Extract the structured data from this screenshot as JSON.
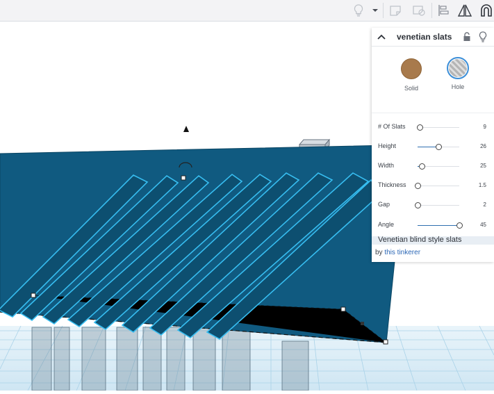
{
  "toolbar": {
    "icons": [
      "lightbulb-icon",
      "chevron-down-icon",
      "note-icon",
      "note-visibility-icon",
      "align-icon",
      "mirror-icon",
      "magnet-icon"
    ]
  },
  "colors": {
    "workplane": "#105a80",
    "slat_outline": "#37bdf0",
    "solid_swatch": "#a87a4c",
    "hole_swatch": "#c8c8c8",
    "panel_accent": "#2e6fb0"
  },
  "shape_panel": {
    "title": "venetian slats",
    "solid_label": "Solid",
    "hole_label": "Hole",
    "selected": "Hole",
    "properties": [
      {
        "label": "# Of Slats",
        "value": "9",
        "fraction": 0.05
      },
      {
        "label": "Height",
        "value": "26",
        "fraction": 0.5
      },
      {
        "label": "Width",
        "value": "25",
        "fraction": 0.1
      },
      {
        "label": "Thickness",
        "value": "1.5",
        "fraction": 0.0
      },
      {
        "label": "Gap",
        "value": "2",
        "fraction": 0.0
      },
      {
        "label": "Angle",
        "value": "45",
        "fraction": 1.0
      }
    ],
    "description": "Venetian blind style slats",
    "author_prefix": "by",
    "author": "this tinkerer"
  }
}
